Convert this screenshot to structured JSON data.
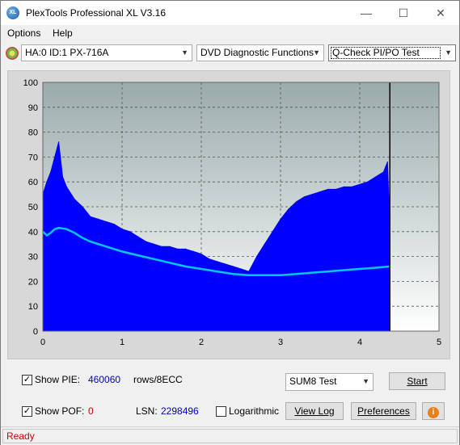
{
  "window": {
    "title": "PlexTools Professional XL V3.16",
    "minimize_glyph": "—",
    "maximize_glyph": "☐",
    "close_glyph": "✕",
    "app_icon_text": "XL"
  },
  "menu": {
    "items": [
      "Options",
      "Help"
    ]
  },
  "toolbar": {
    "drive": "HA:0 ID:1  PX-716A",
    "function": "DVD Diagnostic Functions",
    "test": "Q-Check PI/PO Test"
  },
  "chart_data": {
    "type": "area",
    "xlim": [
      0,
      5
    ],
    "ylim": [
      0,
      100
    ],
    "x_ticks": [
      "0",
      "1",
      "2",
      "3",
      "4",
      "5"
    ],
    "y_ticks": [
      "0",
      "10",
      "20",
      "30",
      "40",
      "50",
      "60",
      "70",
      "80",
      "90",
      "100"
    ],
    "grid": true,
    "scan_end_x": 4.38,
    "series": [
      {
        "kind": "area",
        "color": "#0000ff",
        "x": [
          0.0,
          0.05,
          0.1,
          0.15,
          0.2,
          0.25,
          0.3,
          0.4,
          0.5,
          0.6,
          0.7,
          0.8,
          0.9,
          1.0,
          1.1,
          1.2,
          1.3,
          1.4,
          1.5,
          1.6,
          1.7,
          1.8,
          1.9,
          2.0,
          2.1,
          2.2,
          2.3,
          2.4,
          2.5,
          2.6,
          2.7,
          2.8,
          2.9,
          3.0,
          3.1,
          3.2,
          3.3,
          3.4,
          3.5,
          3.6,
          3.7,
          3.8,
          3.9,
          4.0,
          4.1,
          4.2,
          4.3,
          4.35,
          4.38
        ],
        "y": [
          55,
          60,
          64,
          70,
          76,
          62,
          58,
          53,
          50,
          46,
          45,
          44,
          43,
          41,
          40,
          38,
          36,
          35,
          34,
          34,
          33,
          33,
          32,
          31,
          29,
          28,
          27,
          26,
          25,
          24,
          30,
          35,
          40,
          45,
          49,
          52,
          54,
          55,
          56,
          57,
          57,
          58,
          58,
          59,
          60,
          62,
          64,
          68,
          42
        ]
      },
      {
        "kind": "line",
        "color": "#00c8ff",
        "x": [
          0.0,
          0.05,
          0.1,
          0.15,
          0.2,
          0.3,
          0.4,
          0.5,
          0.6,
          0.8,
          1.0,
          1.2,
          1.4,
          1.6,
          1.8,
          2.0,
          2.2,
          2.4,
          2.6,
          2.8,
          3.0,
          3.2,
          3.4,
          3.6,
          3.8,
          4.0,
          4.2,
          4.38
        ],
        "y": [
          40,
          38.5,
          39.5,
          41,
          41.5,
          41,
          39.5,
          37.5,
          36,
          34,
          32,
          30.5,
          29,
          27.5,
          26,
          25,
          24,
          23,
          22.5,
          22.5,
          22.5,
          23,
          23.5,
          24,
          24.5,
          25,
          25.5,
          26
        ]
      }
    ]
  },
  "controls": {
    "show_pie_label": "Show PIE:",
    "pie_value": "460060",
    "pie_unit": "rows/8ECC",
    "show_pof_label": "Show POF:",
    "pof_value": "0",
    "lsn_label": "LSN:",
    "lsn_value": "2298496",
    "logarithmic_label": "Logarithmic",
    "sum_test": "SUM8 Test",
    "start_label": "Start",
    "view_log_label": "View Log",
    "preferences_label": "Preferences",
    "info_glyph": "i",
    "check_glyph": "✓"
  },
  "status": {
    "text": "Ready"
  }
}
